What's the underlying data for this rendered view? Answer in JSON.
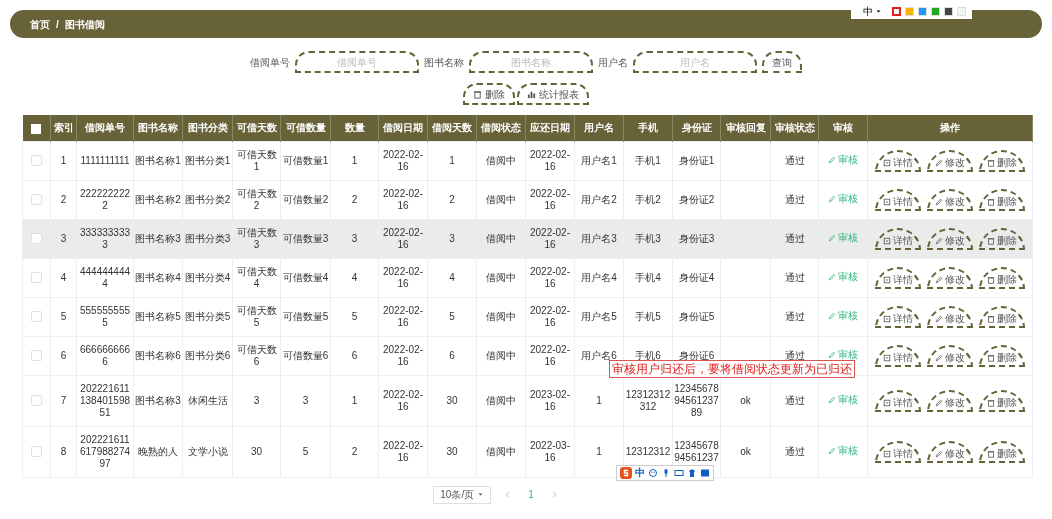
{
  "top_bar": {
    "breadcrumb": [
      "首页",
      "图书借阅"
    ],
    "separator": "/"
  },
  "theme_switcher": {
    "language": "中",
    "swatches": [
      {
        "color": "#e02020",
        "selected": true
      },
      {
        "color": "#f5b400",
        "selected": false
      },
      {
        "color": "#2196f3",
        "selected": false
      },
      {
        "color": "#22a722",
        "selected": false
      },
      {
        "color": "#444444",
        "selected": false
      },
      {
        "color": "#f4f4f4",
        "selected": false
      }
    ]
  },
  "search": {
    "fields": [
      {
        "label": "借阅单号",
        "placeholder": "借阅单号"
      },
      {
        "label": "图书名称",
        "placeholder": "图书名称"
      },
      {
        "label": "用户名",
        "placeholder": "用户名"
      }
    ],
    "submit": "查询",
    "actions": [
      {
        "kind": "delete",
        "label": "删除"
      },
      {
        "kind": "chart",
        "label": "统计报表"
      }
    ]
  },
  "table": {
    "header_checkbox": {
      "checked": false
    },
    "columns": [
      "索引",
      "借阅单号",
      "图书名称",
      "图书分类",
      "可借天数",
      "可借数量",
      "数量",
      "借阅日期",
      "借阅天数",
      "借阅状态",
      "应还日期",
      "用户名",
      "手机",
      "身份证",
      "审核回复",
      "审核状态",
      "审核",
      "操作"
    ],
    "rows": [
      {
        "checked": false,
        "hovered": false,
        "index": "1",
        "borrow_no": "1111111111",
        "book_name": "图书名称1",
        "category": "图书分类1",
        "days_allowed": "可借天数1",
        "qty_allowed": "可借数量1",
        "quantity": "1",
        "borrow_date": "2022-02-16",
        "borrow_days": "1",
        "status": "借阅中",
        "due_date": "2022-02-16",
        "username": "用户名1",
        "phone": "手机1",
        "id_card": "身份证1",
        "review_status": "通过",
        "review": "审核",
        "actions": [
          {
            "kind": "detail",
            "label": "详情"
          },
          {
            "kind": "edit",
            "label": "修改"
          },
          {
            "kind": "delete",
            "label": "删除"
          }
        ]
      },
      {
        "checked": false,
        "hovered": false,
        "index": "2",
        "borrow_no": "2222222222",
        "book_name": "图书名称2",
        "category": "图书分类2",
        "days_allowed": "可借天数2",
        "qty_allowed": "可借数量2",
        "quantity": "2",
        "borrow_date": "2022-02-16",
        "borrow_days": "2",
        "status": "借阅中",
        "due_date": "2022-02-16",
        "username": "用户名2",
        "phone": "手机2",
        "id_card": "身份证2",
        "review_status": "通过",
        "review": "审核",
        "actions": [
          {
            "kind": "detail",
            "label": "详情"
          },
          {
            "kind": "edit",
            "label": "修改"
          },
          {
            "kind": "delete",
            "label": "删除"
          }
        ]
      },
      {
        "checked": false,
        "hovered": true,
        "index": "3",
        "borrow_no": "3333333333",
        "book_name": "图书名称3",
        "category": "图书分类3",
        "days_allowed": "可借天数3",
        "qty_allowed": "可借数量3",
        "quantity": "3",
        "borrow_date": "2022-02-16",
        "borrow_days": "3",
        "status": "借阅中",
        "due_date": "2022-02-16",
        "username": "用户名3",
        "phone": "手机3",
        "id_card": "身份证3",
        "review_status": "通过",
        "review": "审核",
        "actions": [
          {
            "kind": "detail",
            "label": "详情"
          },
          {
            "kind": "edit",
            "label": "修改"
          },
          {
            "kind": "delete",
            "label": "删除"
          }
        ]
      },
      {
        "checked": false,
        "hovered": false,
        "index": "4",
        "borrow_no": "4444444444",
        "book_name": "图书名称4",
        "category": "图书分类4",
        "days_allowed": "可借天数4",
        "qty_allowed": "可借数量4",
        "quantity": "4",
        "borrow_date": "2022-02-16",
        "borrow_days": "4",
        "status": "借阅中",
        "due_date": "2022-02-16",
        "username": "用户名4",
        "phone": "手机4",
        "id_card": "身份证4",
        "review_status": "通过",
        "review": "审核",
        "actions": [
          {
            "kind": "detail",
            "label": "详情"
          },
          {
            "kind": "edit",
            "label": "修改"
          },
          {
            "kind": "delete",
            "label": "删除"
          }
        ]
      },
      {
        "checked": false,
        "hovered": false,
        "index": "5",
        "borrow_no": "5555555555",
        "book_name": "图书名称5",
        "category": "图书分类5",
        "days_allowed": "可借天数5",
        "qty_allowed": "可借数量5",
        "quantity": "5",
        "borrow_date": "2022-02-16",
        "borrow_days": "5",
        "status": "借阅中",
        "due_date": "2022-02-16",
        "username": "用户名5",
        "phone": "手机5",
        "id_card": "身份证5",
        "review_status": "通过",
        "review": "审核",
        "actions": [
          {
            "kind": "detail",
            "label": "详情"
          },
          {
            "kind": "edit",
            "label": "修改"
          },
          {
            "kind": "delete",
            "label": "删除"
          }
        ]
      },
      {
        "checked": false,
        "hovered": false,
        "index": "6",
        "borrow_no": "6666666666",
        "book_name": "图书名称6",
        "category": "图书分类6",
        "days_allowed": "可借天数6",
        "qty_allowed": "可借数量6",
        "quantity": "6",
        "borrow_date": "2022-02-16",
        "borrow_days": "6",
        "status": "借阅中",
        "due_date": "2022-02-16",
        "username": "用户名6",
        "phone": "手机6",
        "id_card": "身份证6",
        "review_status": "通过",
        "review": "审核",
        "actions": [
          {
            "kind": "detail",
            "label": "详情"
          },
          {
            "kind": "edit",
            "label": "修改"
          },
          {
            "kind": "delete",
            "label": "删除"
          }
        ],
        "annotation": "审核用户归还后，要将借阅状态更新为已归还"
      },
      {
        "checked": false,
        "hovered": false,
        "index": "7",
        "borrow_no": "20222161113840159851",
        "book_name": "图书名称3",
        "category": "休闲生活",
        "days_allowed": "3",
        "qty_allowed": "3",
        "quantity": "1",
        "borrow_date": "2022-02-16",
        "borrow_days": "30",
        "status": "借阅中",
        "due_date": "2023-02-16",
        "username": "1",
        "phone": "12312312312",
        "id_card": "123456789456123789",
        "reply": "ok",
        "review_status": "通过",
        "review": "审核",
        "actions": [
          {
            "kind": "detail",
            "label": "详情"
          },
          {
            "kind": "edit",
            "label": "修改"
          },
          {
            "kind": "delete",
            "label": "删除"
          }
        ]
      },
      {
        "checked": false,
        "hovered": false,
        "index": "8",
        "borrow_no": "20222161161798827497",
        "book_name": "晚熟的人",
        "category": "文学小说",
        "days_allowed": "30",
        "qty_allowed": "5",
        "quantity": "2",
        "borrow_date": "2022-02-16",
        "borrow_days": "30",
        "status": "借阅中",
        "due_date": "2022-03-16",
        "username": "1",
        "phone": "12312312",
        "id_card": "1234567894561237",
        "reply": "ok",
        "review_status": "通过",
        "review": "审核",
        "actions": [
          {
            "kind": "detail",
            "label": "详情"
          },
          {
            "kind": "edit",
            "label": "修改"
          },
          {
            "kind": "delete",
            "label": "删除"
          }
        ],
        "ime_toolbar": {
          "mode": "中"
        }
      }
    ]
  },
  "pagination": {
    "page_size": "10条/页",
    "pages": [
      {
        "label": "1",
        "selected": true
      }
    ]
  }
}
